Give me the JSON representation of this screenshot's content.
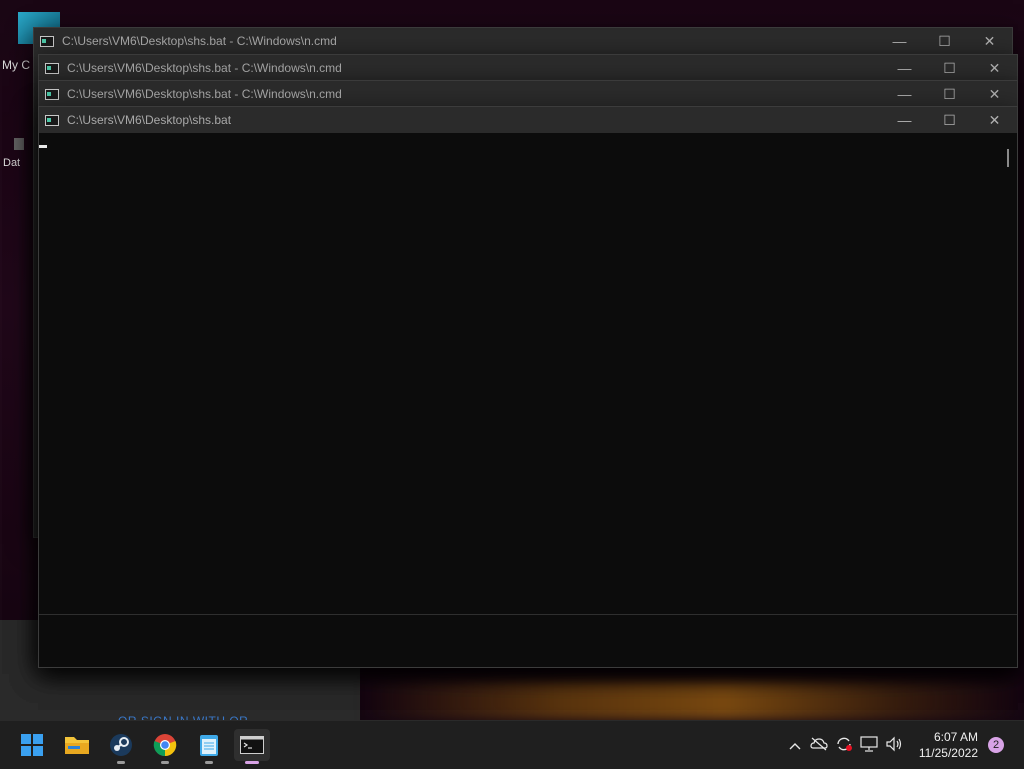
{
  "desktop": {
    "icons": [
      {
        "label": "My C"
      },
      {
        "label": "Dat"
      }
    ],
    "background_link": "OR SIGN IN WITH OR"
  },
  "windows": [
    {
      "title": "C:\\Users\\VM6\\Desktop\\shs.bat - C:\\Windows\\n.cmd"
    },
    {
      "title": "C:\\Users\\VM6\\Desktop\\shs.bat - C:\\Windows\\n.cmd"
    },
    {
      "title": "C:\\Users\\VM6\\Desktop\\shs.bat - C:\\Windows\\n.cmd"
    },
    {
      "title": "C:\\Users\\VM6\\Desktop\\shs.bat"
    }
  ],
  "window_controls": {
    "minimize": "—",
    "maximize": "☐",
    "close": "✕"
  },
  "taskbar": {
    "apps": [
      {
        "name": "start-icon"
      },
      {
        "name": "file-explorer-icon"
      },
      {
        "name": "steam-icon"
      },
      {
        "name": "chrome-icon"
      },
      {
        "name": "notepad-icon"
      },
      {
        "name": "terminal-icon"
      }
    ],
    "clock_time": "6:07 AM",
    "clock_date": "11/25/2022",
    "notification_count": "2"
  },
  "colors": {
    "accent": "#d8a3e6",
    "console_bg": "#0c0c0c",
    "titlebar_bg": "#2b2b2b"
  }
}
